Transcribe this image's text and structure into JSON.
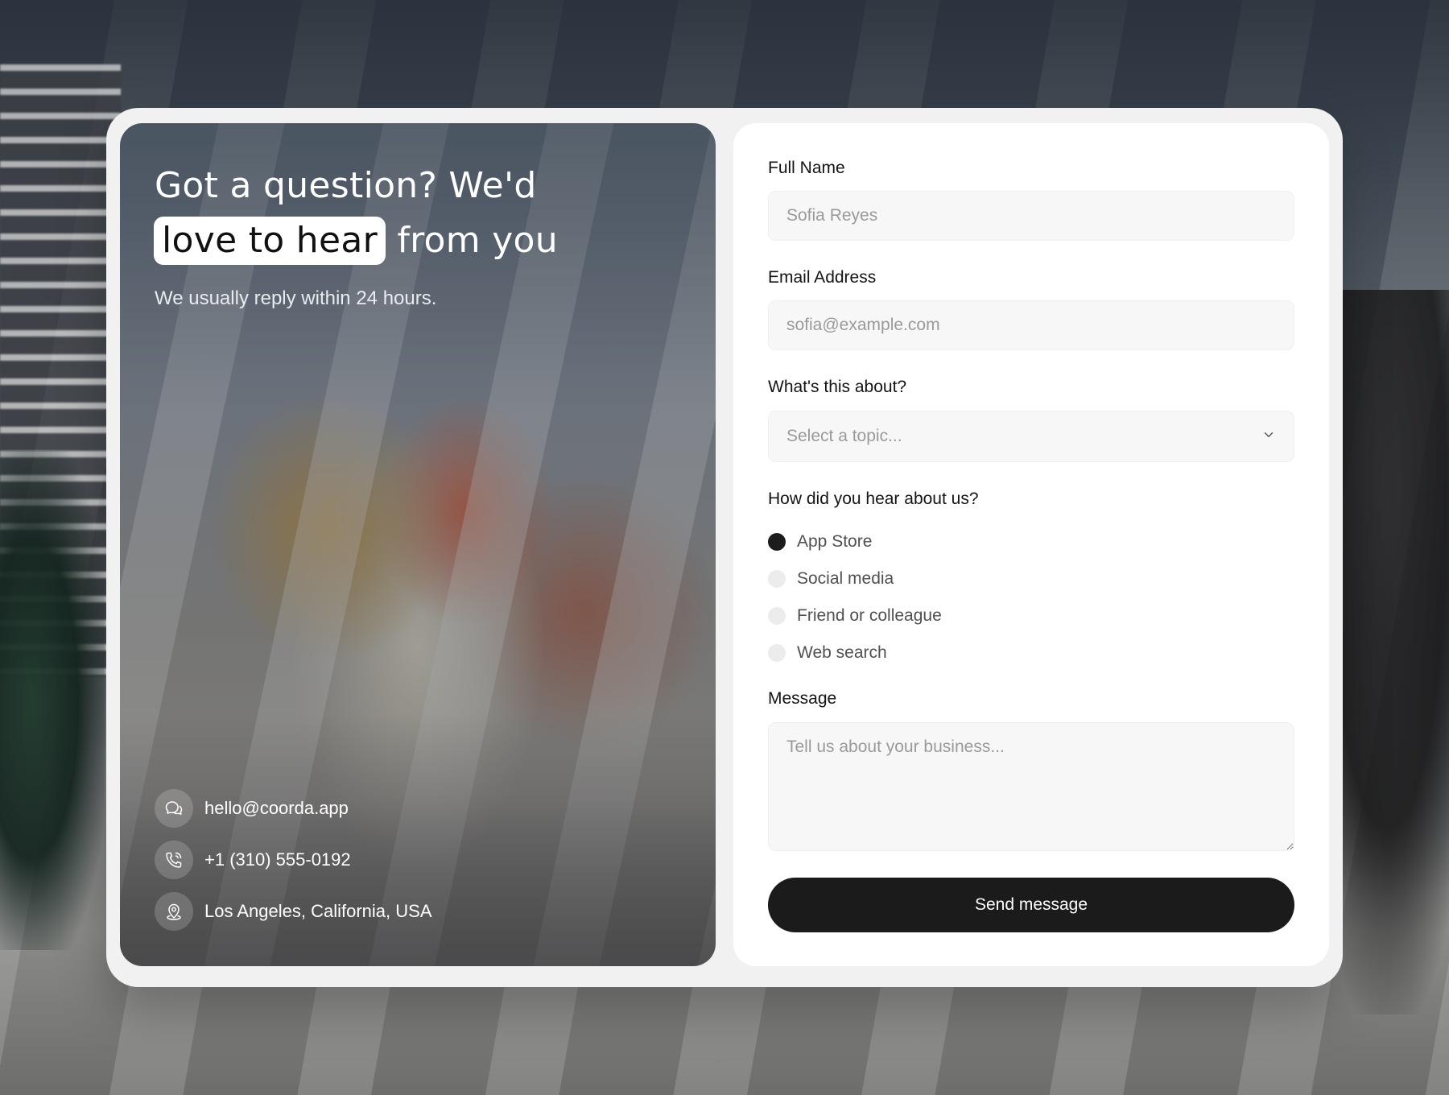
{
  "hero": {
    "heading_line1": "Got a question? We'd",
    "heading_highlight": "love to hear",
    "heading_rest": "from you",
    "subtitle": "We usually reply within 24 hours.",
    "contacts": [
      {
        "icon": "chat-bubbles-icon",
        "text": "hello@coorda.app"
      },
      {
        "icon": "phone-icon",
        "text": "+1 (310) 555-0192"
      },
      {
        "icon": "location-pin-icon",
        "text": "Los Angeles, California, USA"
      }
    ]
  },
  "form": {
    "full_name": {
      "label": "Full Name",
      "placeholder": "Sofia Reyes",
      "value": ""
    },
    "email": {
      "label": "Email Address",
      "placeholder": "sofia@example.com",
      "value": ""
    },
    "topic": {
      "label": "What's this about?",
      "placeholder": "Select a topic...",
      "icon": "chevron-down-icon"
    },
    "referral": {
      "label": "How did you hear about us?",
      "selected": "App Store",
      "options": [
        "App Store",
        "Social media",
        "Friend or colleague",
        "Web search"
      ]
    },
    "message": {
      "label": "Message",
      "placeholder": "Tell us about your business..."
    },
    "submit_label": "Send message"
  },
  "colors": {
    "accent": "#1b1b1b",
    "card": "#ffffff",
    "shell": "#f1f1f1",
    "input_bg": "#f7f7f7",
    "placeholder": "#9a9a9a"
  }
}
